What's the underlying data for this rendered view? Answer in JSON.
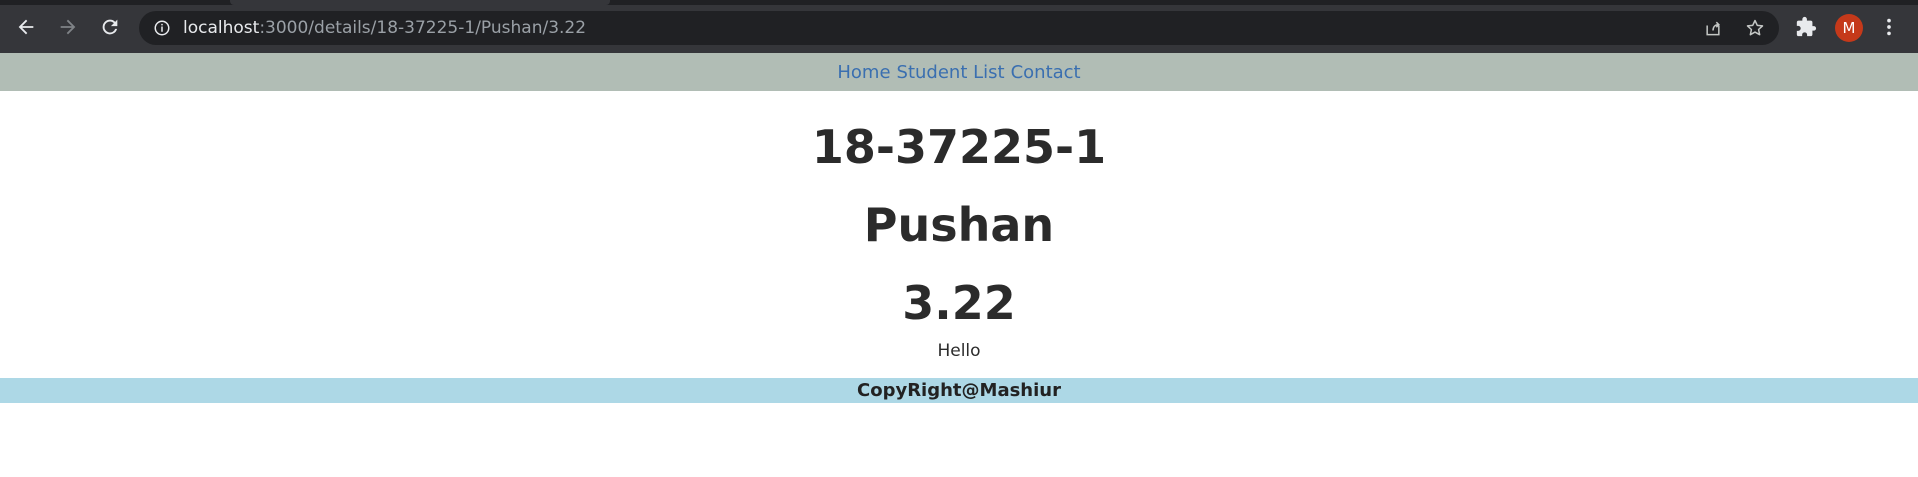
{
  "browser": {
    "url_host": "localhost",
    "url_rest": ":3000/details/18-37225-1/Pushan/3.22",
    "profile_initial": "M"
  },
  "navbar": {
    "links": [
      "Home",
      "Student List",
      "Contact"
    ]
  },
  "student": {
    "id": "18-37225-1",
    "name": "Pushan",
    "gpa": "3.22",
    "message": "Hello"
  },
  "footer": {
    "text": "CopyRight@Mashiur"
  },
  "colors": {
    "navbar_bg": "#b1bdb5",
    "link": "#3a6fb0",
    "footer_bg": "#add8e6",
    "avatar_bg": "#c5391a"
  }
}
